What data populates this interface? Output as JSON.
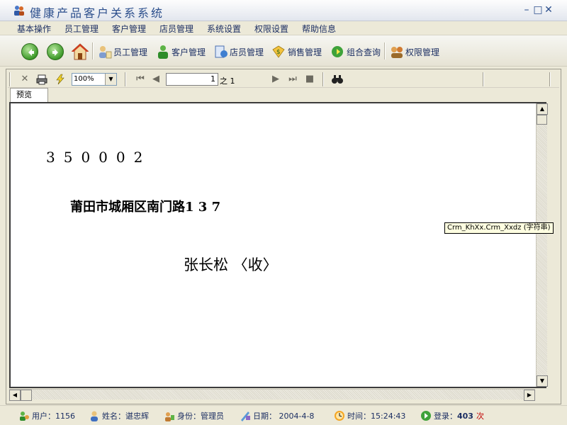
{
  "window": {
    "title": "健康产品客户关系系统",
    "minimize": "–",
    "restore": "□",
    "close": "✕"
  },
  "menu": [
    "基本操作",
    "员工管理",
    "客户管理",
    "店员管理",
    "系统设置",
    "权限设置",
    "帮助信息"
  ],
  "toolbar": {
    "buttons": [
      {
        "label": "员工管理",
        "icon": "employee-icon"
      },
      {
        "label": "客户管理",
        "icon": "customer-icon"
      },
      {
        "label": "店员管理",
        "icon": "clerk-icon"
      },
      {
        "label": "销售管理",
        "icon": "sales-icon"
      },
      {
        "label": "组合查询",
        "icon": "query-icon"
      },
      {
        "label": "权限管理",
        "icon": "permission-icon"
      }
    ]
  },
  "report_toolbar": {
    "zoom": "100%",
    "page_number": "1",
    "page_of": "之 1"
  },
  "tab": {
    "label": "预览"
  },
  "report": {
    "postcode": "350002",
    "address": "莆田市城厢区南门路1 3 7",
    "recipient": "张长松  〈收〉"
  },
  "tooltip": "Crm_KhXx.Crm_Xxdz (字符串)",
  "status": {
    "user_id": "用户：1156",
    "name": "姓名：谌忠辉",
    "role": "身份：管理员",
    "date": "日期：  2004-4-8",
    "time": "时间：15:24:43",
    "login_label": "登录：",
    "login_count": "403",
    "login_unit": "次"
  },
  "colors": {
    "accent": "#1C2F63",
    "title": "#2B4E8C",
    "alert": "#C00000"
  }
}
